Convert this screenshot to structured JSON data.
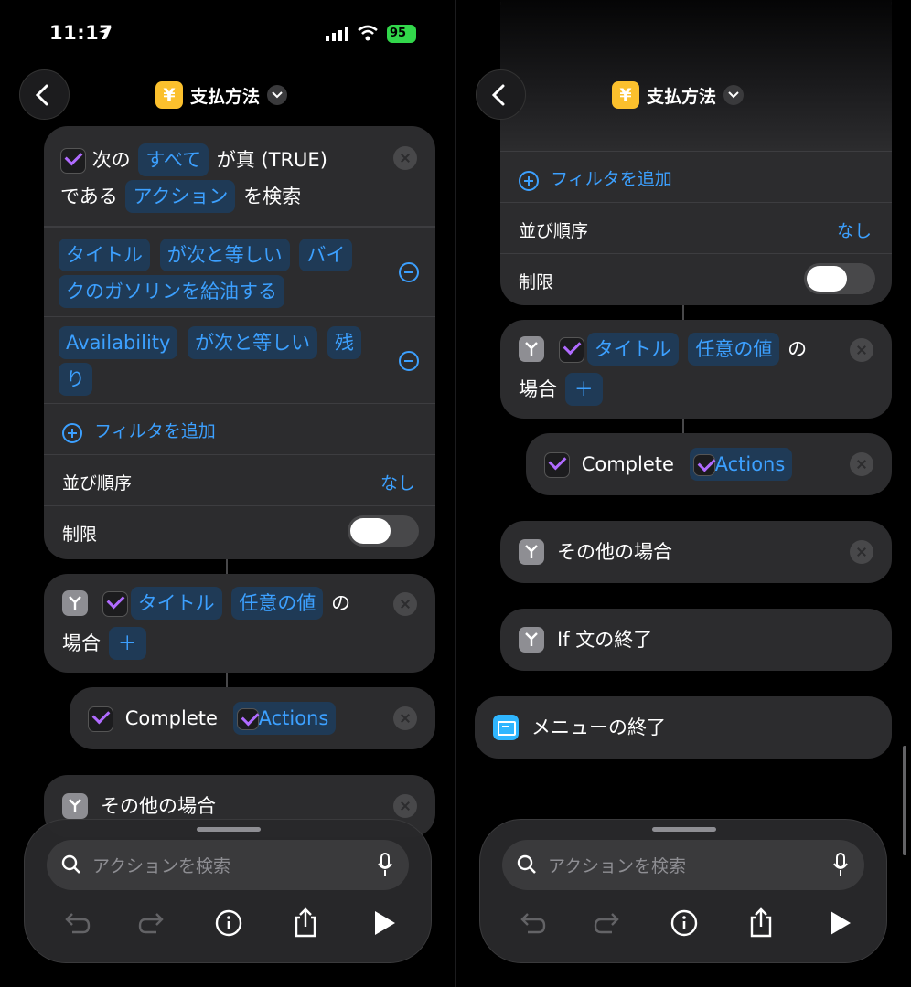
{
  "status": {
    "time": "11:17",
    "battery": "95"
  },
  "nav": {
    "title": "支払方法",
    "yen_glyph": "¥"
  },
  "left": {
    "find_card": {
      "line1_pre": "次の",
      "token_all": "すべて",
      "line1_post": "が真 (TRUE)",
      "line2_pre": "である",
      "token_action": "アクション",
      "line2_post": "を検索",
      "filter1": {
        "field": "タイトル",
        "op": "が次と等しい",
        "value_a": "バイ",
        "value_b": "クのガソリンを給油する"
      },
      "filter2": {
        "field": "Availability",
        "op": "が次と等しい",
        "value_a": "残",
        "value_b": "り"
      },
      "add_filter": "フィルタを追加",
      "sort_label": "並び順序",
      "sort_value": "なし",
      "limit_label": "制限"
    },
    "if_card": {
      "token_title": "タイトル",
      "token_any": "任意の値",
      "of": "の",
      "line2": "場合"
    },
    "complete_card": {
      "label": "Complete",
      "token": "Actions"
    },
    "otherwise_card": {
      "label": "その他の場合"
    }
  },
  "right": {
    "find_tail": {
      "add_filter": "フィルタを追加",
      "sort_label": "並び順序",
      "sort_value": "なし",
      "limit_label": "制限"
    },
    "if_card": {
      "token_title": "タイトル",
      "token_any": "任意の値",
      "of": "の",
      "line2": "場合"
    },
    "complete_card": {
      "label": "Complete",
      "token": "Actions"
    },
    "otherwise_card": {
      "label": "その他の場合"
    },
    "end_if_card": {
      "label": "If 文の終了"
    },
    "end_menu_card": {
      "label": "メニューの終了"
    }
  },
  "bottom": {
    "search_placeholder": "アクションを検索"
  }
}
